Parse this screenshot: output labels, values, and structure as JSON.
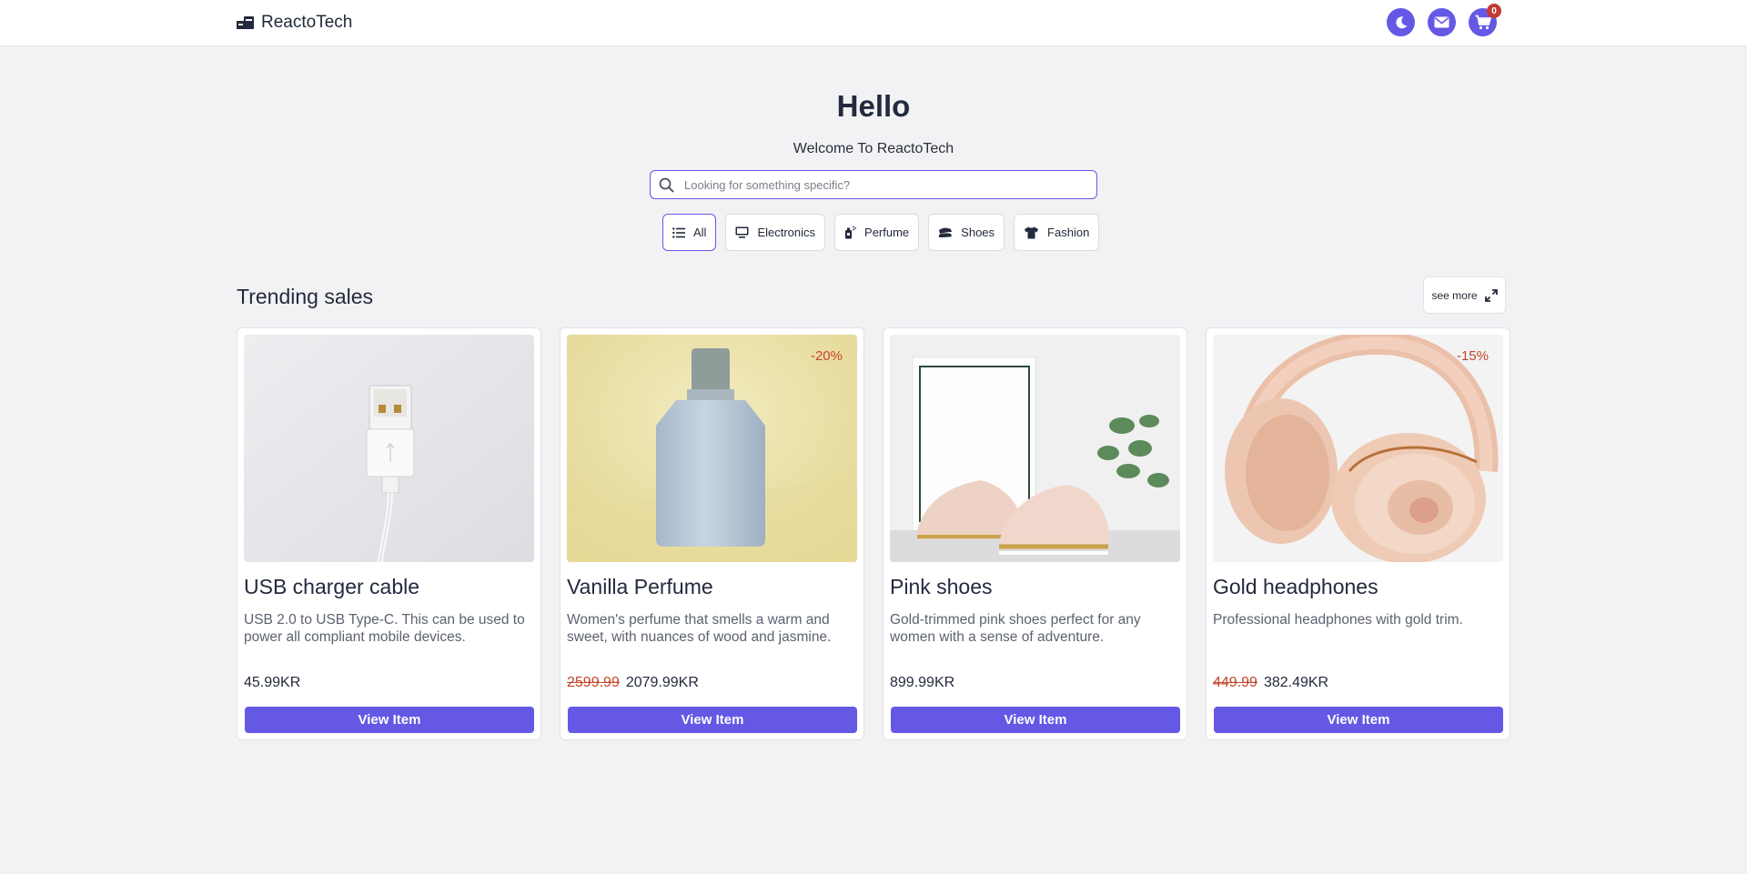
{
  "header": {
    "brand": "ReactoTech",
    "icons": [
      "theme-toggle-icon",
      "mail-icon",
      "cart-icon"
    ],
    "cart_count": "0",
    "accent_color": "#6458e5"
  },
  "hero": {
    "title": "Hello",
    "subtitle": "Welcome To ReactoTech",
    "search_placeholder": "Looking for something specific?",
    "search_value": ""
  },
  "categories": [
    {
      "label": "All",
      "icon": "list-icon",
      "active": true
    },
    {
      "label": "Electronics",
      "icon": "monitor-icon",
      "active": false
    },
    {
      "label": "Perfume",
      "icon": "perfume-icon",
      "active": false
    },
    {
      "label": "Shoes",
      "icon": "shoe-icon",
      "active": false
    },
    {
      "label": "Fashion",
      "icon": "shirt-icon",
      "active": false
    }
  ],
  "section": {
    "title": "Trending sales",
    "see_more": "see more"
  },
  "products": [
    {
      "name": "USB charger cable",
      "description": "USB 2.0 to USB Type-C. This can be used to power all compliant mobile devices.",
      "old_price": "",
      "price": "45.99KR",
      "discount": "",
      "button": "View Item"
    },
    {
      "name": "Vanilla Perfume",
      "description": "Women's perfume that smells a warm and sweet, with nuances of wood and jasmine.",
      "old_price": "2599.99",
      "price": "2079.99KR",
      "discount": "-20%",
      "button": "View Item"
    },
    {
      "name": "Pink shoes",
      "description": "Gold-trimmed pink shoes perfect for any women with a sense of adventure.",
      "old_price": "",
      "price": "899.99KR",
      "discount": "",
      "button": "View Item"
    },
    {
      "name": "Gold headphones",
      "description": "Professional headphones with gold trim.",
      "old_price": "449.99",
      "price": "382.49KR",
      "discount": "-15%",
      "button": "View Item"
    }
  ]
}
